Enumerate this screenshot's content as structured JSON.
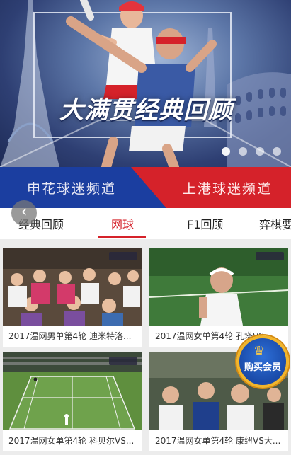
{
  "hero": {
    "title": "大满贯经典回顾",
    "carousel_count": 4,
    "active_index": 0
  },
  "channels": {
    "left": "申花球迷频道",
    "right": "上港球迷频道"
  },
  "tabs": [
    {
      "label": "经典回顾",
      "active": false
    },
    {
      "label": "网球",
      "active": true
    },
    {
      "label": "F1回顾",
      "active": false
    },
    {
      "label": "弈棋要",
      "active": false
    }
  ],
  "back_icon": "chevron-left-icon",
  "videos": [
    {
      "title": "2017温网男单第4轮 迪米特洛..."
    },
    {
      "title": "2017温网女单第4轮 孔塔VS..."
    },
    {
      "title": "2017温网女单第4轮 科贝尔VS..."
    },
    {
      "title": "2017温网女单第4轮 康纽VS大..."
    }
  ],
  "vip": {
    "label": "购买会员",
    "icon": "crown-icon"
  },
  "colors": {
    "accent": "#d5222a",
    "blue": "#1b3ea0",
    "red": "#d5222a"
  }
}
